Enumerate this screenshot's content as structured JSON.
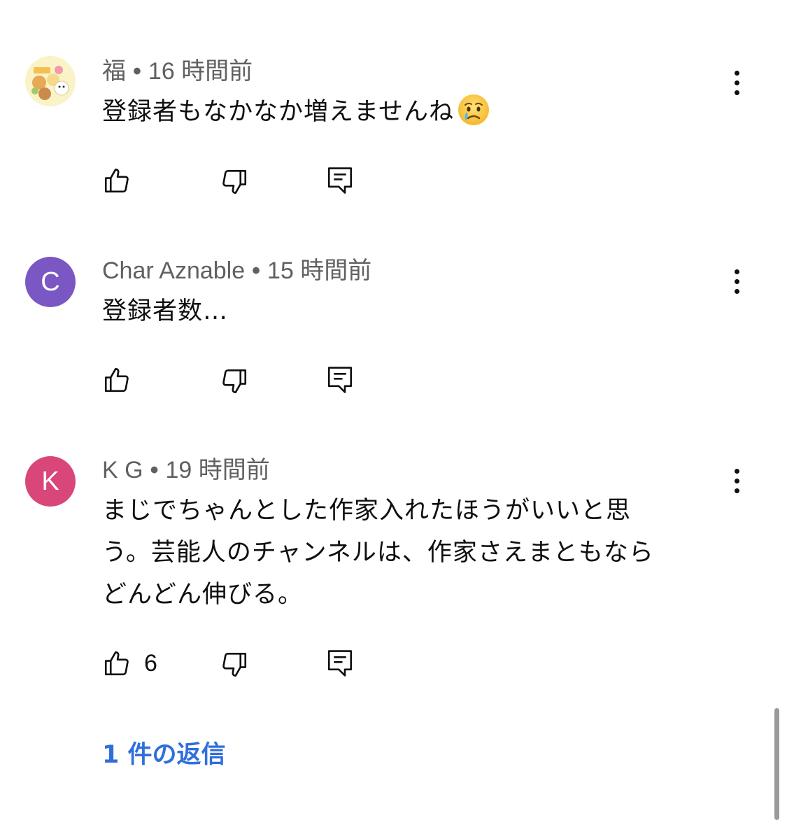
{
  "comments": [
    {
      "author": "福",
      "separator": "•",
      "time": "16 時間前",
      "text": "登録者もなかなか増えませんね",
      "emoji": "crying-face-emoji",
      "likes": "",
      "avatar_type": "illustration"
    },
    {
      "author": "Char Aznable",
      "separator": "•",
      "time": "15 時間前",
      "text": "登録者数…",
      "likes": "",
      "avatar_letter": "C",
      "avatar_color": "#7b57c4"
    },
    {
      "author": "K G",
      "separator": "•",
      "time": "19 時間前",
      "text_lines": [
        "まじでちゃんとした作家入れたほうがいいと思",
        "う。芸能人のチャンネルは、作家さえまともなら",
        "どんどん伸びる。"
      ],
      "likes": "6",
      "avatar_letter": "K",
      "avatar_color": "#d9467a"
    }
  ],
  "replies_link": "1 件の返信",
  "colors": {
    "link": "#2f6fdb",
    "meta_text": "#606060",
    "scrollbar": "#9a9a9a"
  },
  "icons": [
    "thumbs-up-icon",
    "thumbs-down-icon",
    "reply-icon",
    "more-vert-icon"
  ]
}
